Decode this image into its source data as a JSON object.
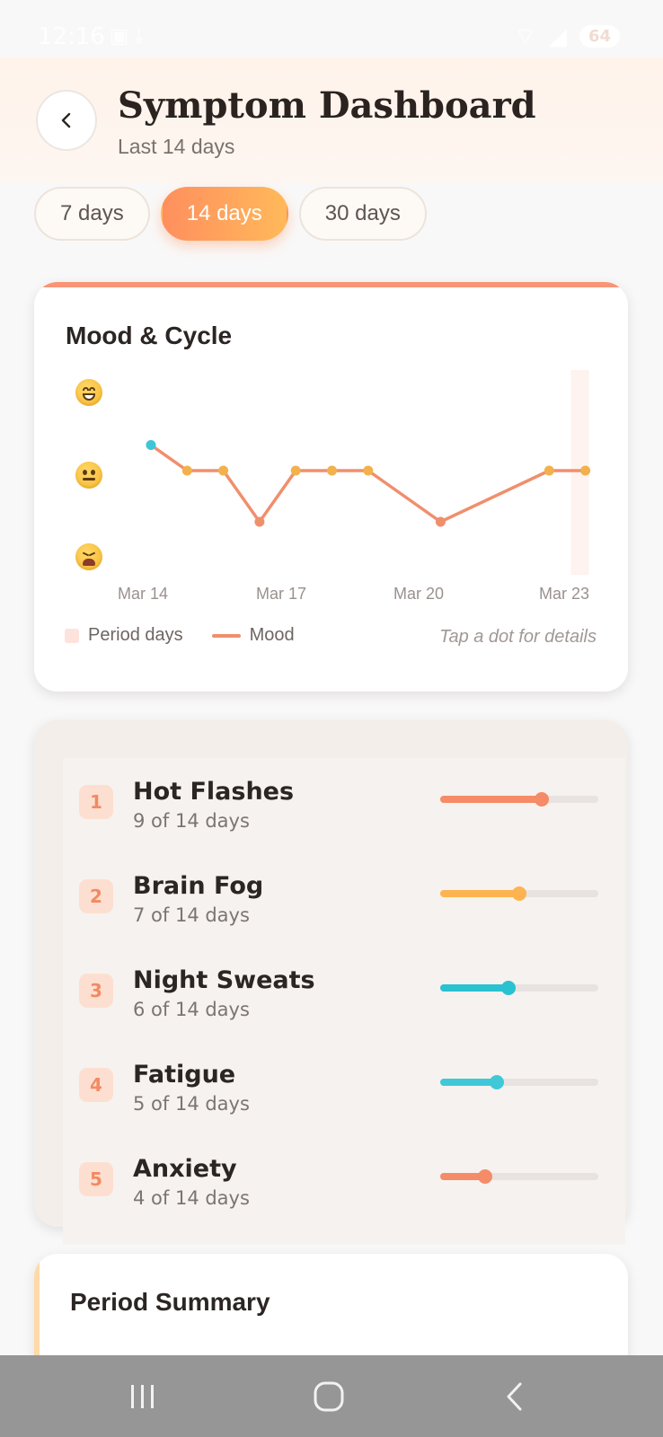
{
  "status_bar": {
    "time": "12:16",
    "battery": "64"
  },
  "header": {
    "title": "Symptom Dashboard",
    "subtitle": "Last 14 days",
    "back_icon": "chevron-left-icon"
  },
  "range_tabs": [
    {
      "label": "7 days",
      "active": false
    },
    {
      "label": "14 days",
      "active": true
    },
    {
      "label": "30 days",
      "active": false
    }
  ],
  "mood_card": {
    "title": "Mood & Cycle",
    "accent_color": "#f79576",
    "legend": {
      "period": "Period days",
      "mood": "Mood"
    },
    "hint": "Tap a dot for details",
    "y_levels": [
      "happy-face-icon",
      "neutral-face-icon",
      "tired-face-icon"
    ]
  },
  "chart_data": {
    "type": "line",
    "x_tick_labels": [
      "Mar 14",
      "Mar 17",
      "Mar 20",
      "Mar 23"
    ],
    "series": [
      {
        "name": "Mood",
        "color": "#f08f6c",
        "x": [
          "Mar 14",
          "Mar 15",
          "Mar 16",
          "Mar 17",
          "Mar 18",
          "Mar 19",
          "Mar 20",
          "Mar 21",
          "Mar 22",
          "Mar 23",
          "Mar 24",
          "Mar 25",
          "Mar 26",
          "Mar 27"
        ],
        "values": [
          2.5,
          2,
          2,
          1,
          2,
          2,
          2,
          null,
          1,
          null,
          null,
          2,
          2,
          null
        ],
        "point_colors": [
          "#3cc6d8",
          "#f2b14c",
          "#f2b14c",
          "#f08f6c",
          "#f2b14c",
          "#f2b14c",
          "#f2b14c",
          null,
          "#f08f6c",
          null,
          null,
          "#f2b14c",
          "#f2b14c",
          null
        ]
      }
    ],
    "period_days": [
      "Mar 26"
    ],
    "ylim": [
      1,
      3
    ],
    "y_labels": [
      "tired",
      "neutral",
      "happy"
    ],
    "legend_placement": "bottom-left"
  },
  "symptoms": [
    {
      "rank": "1",
      "name": "Hot Flashes",
      "count": "9 of 14 days",
      "fraction": 0.643,
      "color": "#f58b67"
    },
    {
      "rank": "2",
      "name": "Brain Fog",
      "count": "7 of 14 days",
      "fraction": 0.5,
      "color": "#fdb34f"
    },
    {
      "rank": "3",
      "name": "Night Sweats",
      "count": "6 of 14 days",
      "fraction": 0.429,
      "color": "#2ac1d1"
    },
    {
      "rank": "4",
      "name": "Fatigue",
      "count": "5 of 14 days",
      "fraction": 0.357,
      "color": "#41c8d8"
    },
    {
      "rank": "5",
      "name": "Anxiety",
      "count": "4 of 14 days",
      "fraction": 0.286,
      "color": "#f58b67"
    }
  ],
  "period_card": {
    "title": "Period Summary"
  },
  "nav": {
    "recent": "recent-apps-icon",
    "home": "home-icon",
    "back": "back-icon"
  }
}
